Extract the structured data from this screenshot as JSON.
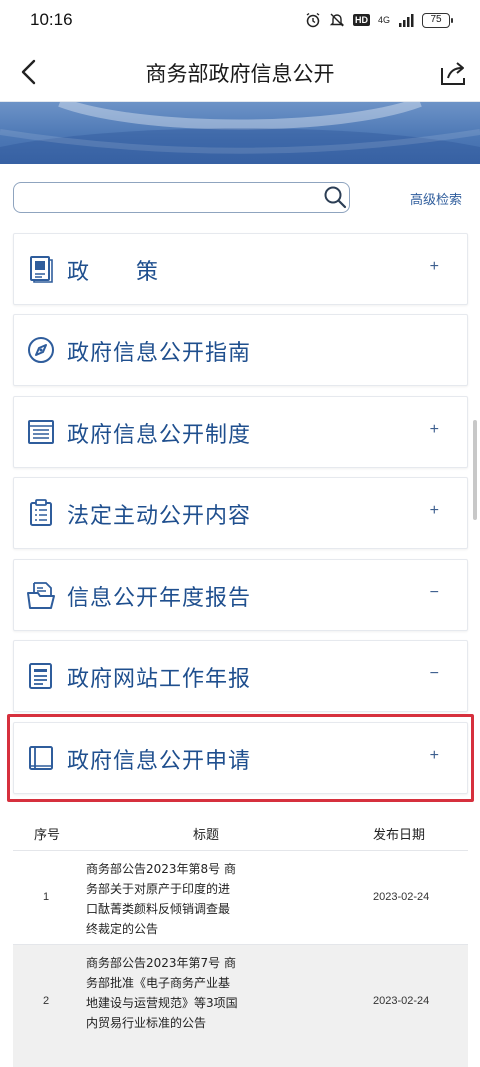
{
  "status": {
    "time": "10:16",
    "hd": "HD",
    "signal": "4G",
    "battery": "75"
  },
  "header": {
    "title": "商务部政府信息公开"
  },
  "search": {
    "placeholder": "",
    "advanced_label": "高级检索"
  },
  "menu": [
    {
      "label": "政　　策",
      "toggle": "+",
      "icon": "policy-document-icon"
    },
    {
      "label": "政府信息公开指南",
      "toggle": "",
      "icon": "compass-icon"
    },
    {
      "label": "政府信息公开制度",
      "toggle": "+",
      "icon": "list-document-icon"
    },
    {
      "label": "法定主动公开内容",
      "toggle": "+",
      "icon": "clipboard-icon"
    },
    {
      "label": "信息公开年度报告",
      "toggle": "−",
      "icon": "folder-document-icon"
    },
    {
      "label": "政府网站工作年报",
      "toggle": "−",
      "icon": "report-document-icon"
    },
    {
      "label": "政府信息公开申请",
      "toggle": "+",
      "icon": "book-icon"
    }
  ],
  "table": {
    "headers": {
      "no": "序号",
      "title": "标题",
      "date": "发布日期"
    },
    "rows": [
      {
        "no": "1",
        "title": "商务部公告2023年第8号 商务部关于对原产于印度的进口酞菁类颜料反倾销调查最终裁定的公告",
        "date": "2023-02-24"
      },
      {
        "no": "2",
        "title": "商务部公告2023年第7号 商务部批准《电子商务产业基地建设与运营规范》等3项国内贸易行业标准的公告",
        "date": "2023-02-24"
      }
    ]
  },
  "colors": {
    "accent": "#1f4f8e",
    "highlight": "#d6303d",
    "banner": "#4d78b5"
  }
}
